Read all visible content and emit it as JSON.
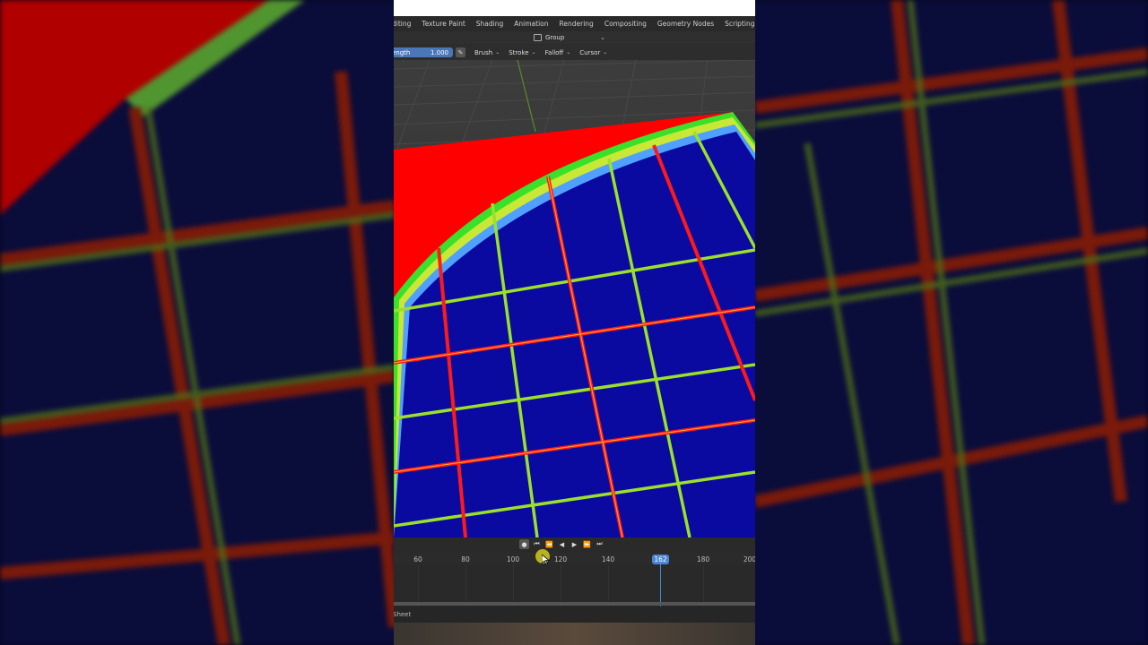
{
  "workspace_tabs": [
    "diting",
    "Texture Paint",
    "Shading",
    "Animation",
    "Rendering",
    "Compositing",
    "Geometry Nodes",
    "Scripting"
  ],
  "header": {
    "group_label": "Group"
  },
  "tool_settings": {
    "strength_label": "ength",
    "strength_value": "1.000",
    "menus": [
      "Brush",
      "Stroke",
      "Falloff",
      "Cursor"
    ]
  },
  "timeline": {
    "ticks": [
      "60",
      "80",
      "100",
      "120",
      "140",
      "180",
      "200"
    ],
    "current_frame": "162"
  },
  "status": {
    "editor_label": "Sheet"
  },
  "icons": {
    "group": "group-data-icon",
    "pen": "pen-pressure-icon",
    "record": "record-icon",
    "jump_start": "jump-start-icon",
    "jump_keyframe_back": "prev-keyframe-icon",
    "play_reverse": "play-reverse-icon",
    "play": "play-icon",
    "jump_keyframe_fwd": "next-keyframe-icon",
    "jump_end": "jump-end-icon"
  },
  "colors": {
    "accent_blue": "#4a86d6",
    "weight_red": "#ff0000",
    "weight_blue": "#0a0aa0",
    "weight_green": "#9be02a",
    "cursor_yellow": "#c8c21b"
  }
}
